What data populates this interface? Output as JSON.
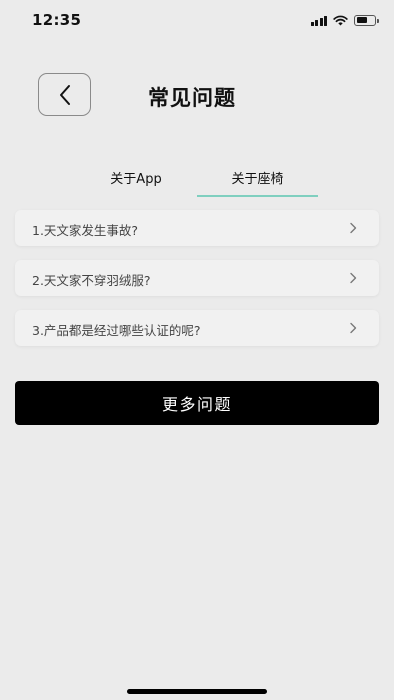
{
  "status_bar": {
    "time": "12:35",
    "icons": [
      "cellular-signal-icon",
      "wifi-icon",
      "battery-icon"
    ]
  },
  "header": {
    "title": "常见问题",
    "back_icon": "chevron-left-icon"
  },
  "tabs": [
    {
      "label": "关于App",
      "selected": false
    },
    {
      "label": "关于座椅",
      "selected": true
    }
  ],
  "faq": [
    {
      "question": "1.天文家发生事故?"
    },
    {
      "question": "2.天文家不穿羽绒服?"
    },
    {
      "question": "3.产品都是经过哪些认证的呢?"
    }
  ],
  "more_button": {
    "label": "更多问题"
  },
  "colors": {
    "background": "#ebebeb",
    "tab_indicator": "#7fcfbf",
    "primary_button": "#000000"
  }
}
